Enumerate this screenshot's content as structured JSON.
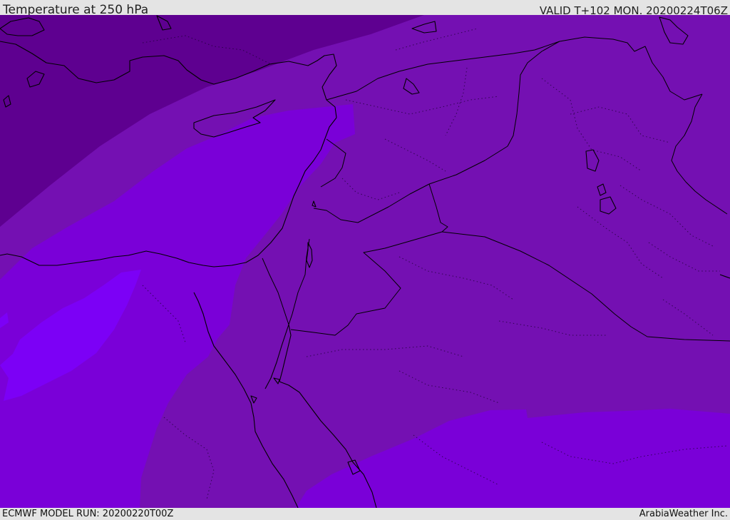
{
  "header": {
    "title": "Temperature at 250 hPa",
    "valid": "VALID T+102 MON. 20200224T06Z"
  },
  "footer": {
    "model_run": "ECMWF MODEL RUN: 20200220T00Z",
    "credit": "ArabiaWeather Inc."
  },
  "map": {
    "region": "Eastern Mediterranean and Middle East",
    "field_colors": {
      "coldest": "#5e0090",
      "cold": "#7410b2",
      "mid": "#7a00d8",
      "warm": "#7c00f6"
    },
    "coastline_color": "#000000",
    "border_style": "solid black",
    "province_border_style": "dotted"
  }
}
